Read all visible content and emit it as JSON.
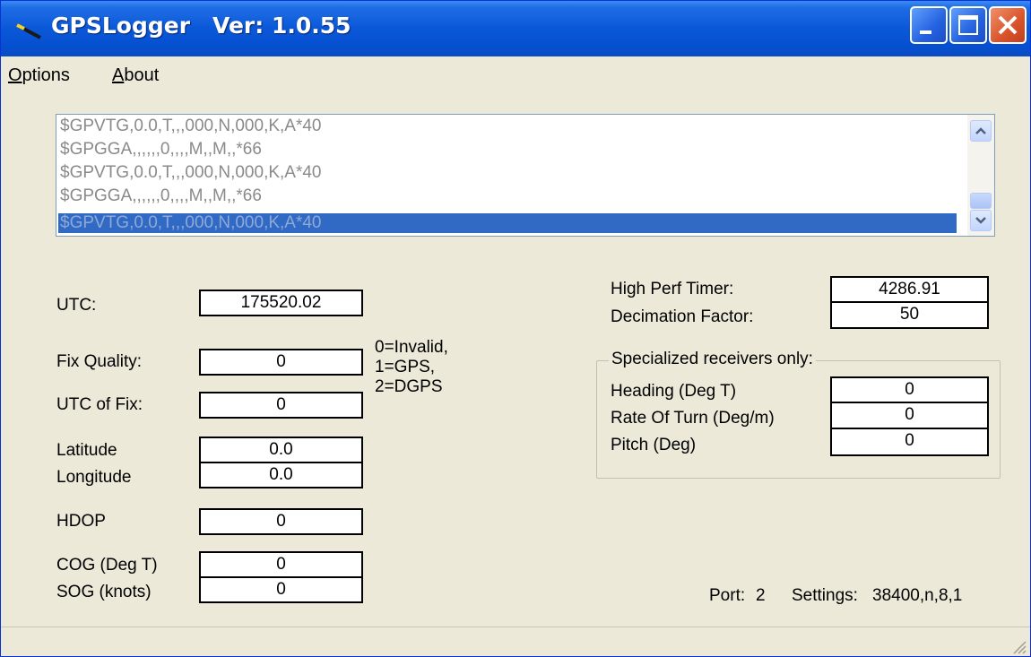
{
  "window": {
    "app_name": "GPSLogger",
    "version": "Ver: 1.0.55"
  },
  "menu": {
    "items": [
      "Options",
      "About"
    ]
  },
  "nmea_log": {
    "lines": [
      "$GPVTG,0.0,T,,,000,N,000,K,A*40",
      "$GPGGA,,,,,,0,,,,M,,M,,*66",
      "$GPVTG,0.0,T,,,000,N,000,K,A*40",
      "$GPGGA,,,,,,0,,,,M,,M,,*66",
      "$GPVTG,0.0,T,,,000,N,000,K,A*40"
    ],
    "selected_index": 4
  },
  "fields": {
    "utc": {
      "label": "UTC:",
      "value": "175520.02"
    },
    "fix_quality": {
      "label": "Fix Quality:",
      "value": "0"
    },
    "utc_of_fix": {
      "label": "UTC of Fix:",
      "value": "0"
    },
    "latitude": {
      "label": "Latitude",
      "value": "0.0"
    },
    "longitude": {
      "label": "Longitude",
      "value": "0.0"
    },
    "hdop": {
      "label": "HDOP",
      "value": "0"
    },
    "cog": {
      "label": "COG (Deg T)",
      "value": "0"
    },
    "sog": {
      "label": "SOG (knots)",
      "value": "0"
    },
    "high_perf_timer": {
      "label": "High Perf Timer:",
      "value": "4286.91"
    },
    "decimation_factor": {
      "label": "Decimation Factor:",
      "value": "50"
    }
  },
  "fix_legend": [
    "0=Invalid,",
    "1=GPS,",
    "2=DGPS"
  ],
  "specialized": {
    "title": "Specialized receivers only:",
    "heading": {
      "label": "Heading (Deg T)",
      "value": "0"
    },
    "rate_of_turn": {
      "label": "Rate Of Turn (Deg/m)",
      "value": "0"
    },
    "pitch": {
      "label": "Pitch (Deg)",
      "value": "0"
    }
  },
  "port_info": {
    "port_label": "Port:",
    "port": "2",
    "settings_label": "Settings:",
    "settings": "38400,n,8,1"
  },
  "colors": {
    "titlebar": "#0a58d8",
    "selection": "#316ac5",
    "window_bg": "#ece9d8"
  }
}
